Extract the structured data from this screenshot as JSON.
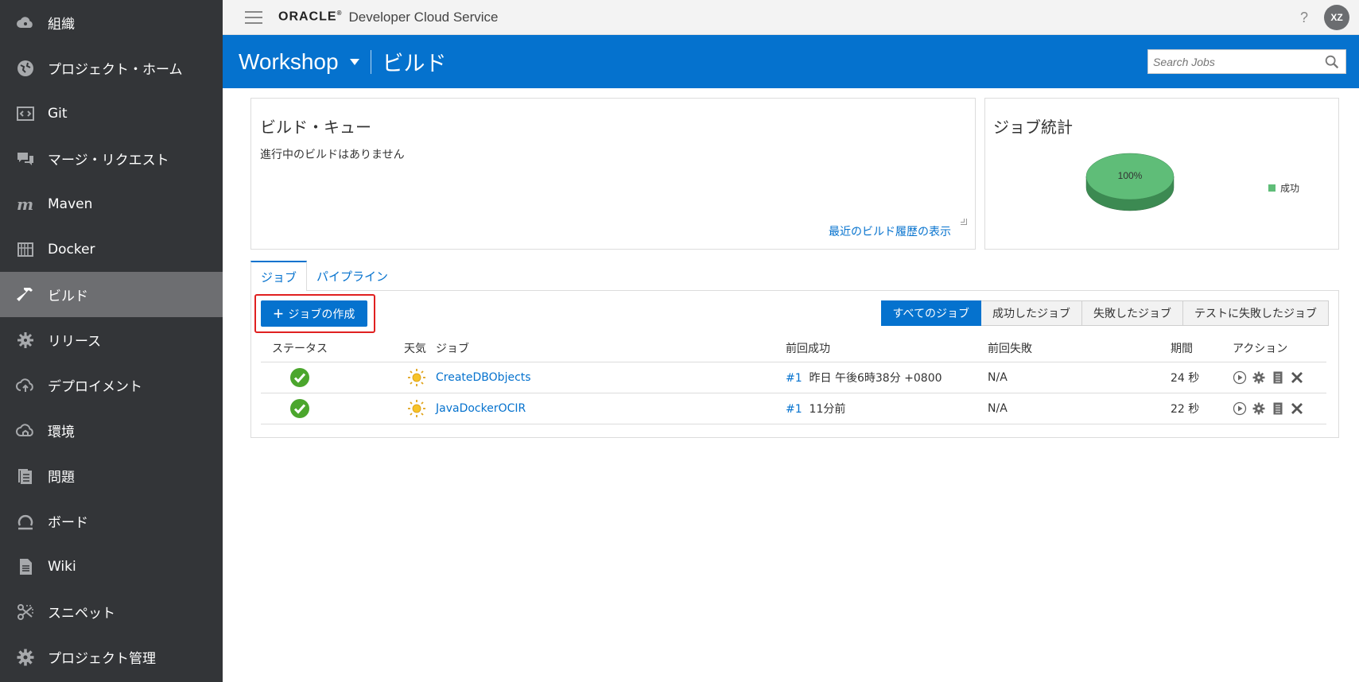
{
  "sidebar": {
    "items": [
      {
        "label": "組織",
        "icon": "cloud-people-icon",
        "active": false
      },
      {
        "label": "プロジェクト・ホーム",
        "icon": "globe-icon",
        "active": false
      },
      {
        "label": "Git",
        "icon": "code-icon",
        "active": false
      },
      {
        "label": "マージ・リクエスト",
        "icon": "chat-icon",
        "active": false
      },
      {
        "label": "Maven",
        "icon": "maven-icon",
        "active": false
      },
      {
        "label": "Docker",
        "icon": "docker-icon",
        "active": false
      },
      {
        "label": "ビルド",
        "icon": "hammer-icon",
        "active": true
      },
      {
        "label": "リリース",
        "icon": "release-gear-icon",
        "active": false
      },
      {
        "label": "デプロイメント",
        "icon": "cloud-upload-icon",
        "active": false
      },
      {
        "label": "環境",
        "icon": "cloud-home-icon",
        "active": false
      },
      {
        "label": "問題",
        "icon": "issues-icon",
        "active": false
      },
      {
        "label": "ボード",
        "icon": "board-icon",
        "active": false
      },
      {
        "label": "Wiki",
        "icon": "document-icon",
        "active": false
      },
      {
        "label": "スニペット",
        "icon": "scissors-icon",
        "active": false
      },
      {
        "label": "プロジェクト管理",
        "icon": "gear-icon",
        "active": false
      }
    ]
  },
  "header": {
    "logo": "ORACLE",
    "logo_mark": "®",
    "product": "Developer Cloud Service",
    "help": "?",
    "avatar": "XZ"
  },
  "project_bar": {
    "project": "Workshop",
    "section": "ビルド",
    "search_placeholder": "Search Jobs"
  },
  "build_queue": {
    "title": "ビルド・キュー",
    "empty_message": "進行中のビルドはありません",
    "history_link": "最近のビルド履歴の表示"
  },
  "job_stats": {
    "title": "ジョブ統計",
    "pie_label": "100%",
    "legend": "成功",
    "success_fraction": 1.0,
    "colors": {
      "success": "#5fbd78",
      "success_dark": "#3c8a52"
    }
  },
  "tabs": [
    {
      "label": "ジョブ",
      "active": true
    },
    {
      "label": "パイプライン",
      "active": false
    }
  ],
  "jobs": {
    "create_button": "ジョブの作成",
    "filters": [
      {
        "label": "すべてのジョブ",
        "active": true
      },
      {
        "label": "成功したジョブ",
        "active": false
      },
      {
        "label": "失敗したジョブ",
        "active": false
      },
      {
        "label": "テストに失敗したジョブ",
        "active": false
      }
    ],
    "columns": {
      "status": "ステータス",
      "weather": "天気",
      "job": "ジョブ",
      "last_success": "前回成功",
      "last_failure": "前回失敗",
      "duration": "期間",
      "actions": "アクション"
    },
    "rows": [
      {
        "status": "success",
        "weather": "sunny",
        "name": "CreateDBObjects",
        "build": "#1",
        "last_success": "昨日 午後6時38分 +0800",
        "last_failure": "N/A",
        "duration": "24 秒"
      },
      {
        "status": "success",
        "weather": "sunny",
        "name": "JavaDockerOCIR",
        "build": "#1",
        "last_success": "11分前",
        "last_failure": "N/A",
        "duration": "22 秒"
      }
    ]
  },
  "colors": {
    "accent": "#0572ce",
    "sidebar_bg": "#333538",
    "sidebar_active": "#6d6e71",
    "success": "#4ba62d",
    "highlight_box": "#e02020"
  }
}
